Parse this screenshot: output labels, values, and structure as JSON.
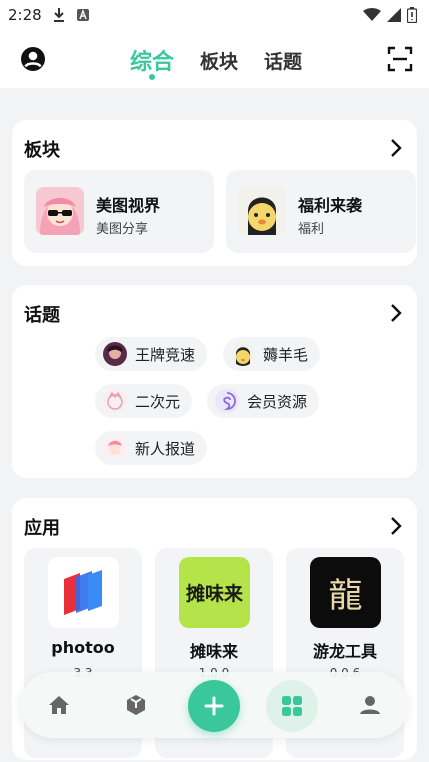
{
  "status_bar": {
    "time": "2:28"
  },
  "top_tabs": {
    "items": [
      "综合",
      "板块",
      "话题"
    ],
    "active": "综合"
  },
  "boards_section": {
    "title": "板块",
    "items": [
      {
        "name": "美图视界",
        "sub": "美图分享"
      },
      {
        "name": "福利来袭",
        "sub": "福利"
      }
    ]
  },
  "topics_section": {
    "title": "话题",
    "chips": [
      "王牌竞速",
      "薅羊毛",
      "二次元",
      "会员资源",
      "新人报道"
    ]
  },
  "apps_section": {
    "title": "应用",
    "items": [
      {
        "name": "photoo",
        "version": "3.3"
      },
      {
        "name": "摊味来",
        "version": "1.0.0",
        "icon_text": "摊味来"
      },
      {
        "name": "游龙工具",
        "version": "0.0.6",
        "icon_text": "龍"
      }
    ]
  },
  "bottom_nav": {
    "items": [
      "home-icon",
      "cube-icon",
      "plus-icon",
      "grid-icon",
      "profile-icon"
    ],
    "active": "grid-icon"
  },
  "colors": {
    "accent": "#3ac79a",
    "card": "#ffffff",
    "background": "#f1f3f5"
  }
}
